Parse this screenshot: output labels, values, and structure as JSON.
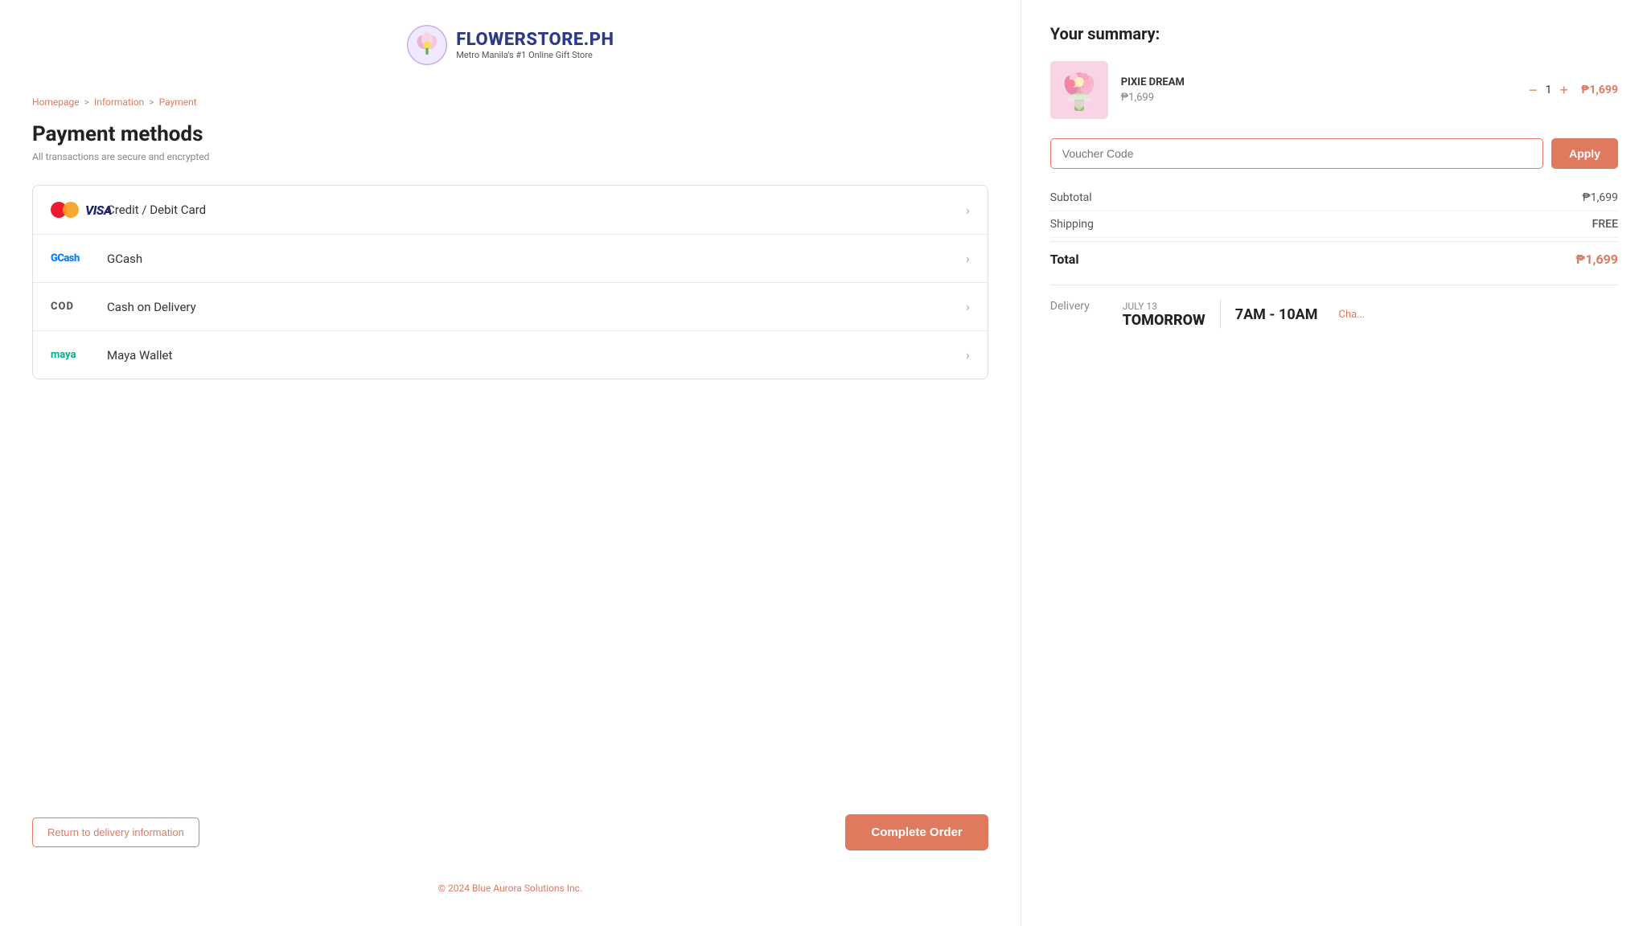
{
  "logo": {
    "title": "FLOWERSTORE.PH",
    "subtitle": "Metro Manila's #1 Online Gift Store"
  },
  "breadcrumb": {
    "homepage": "Homepage",
    "information": "Information",
    "payment": "Payment"
  },
  "page": {
    "title": "Payment methods",
    "secure_text": "All transactions are secure and encrypted"
  },
  "payment_methods": [
    {
      "id": "credit-debit",
      "label": "Credit / Debit Card",
      "icon_type": "visa"
    },
    {
      "id": "gcash",
      "label": "GCash",
      "icon_type": "gcash"
    },
    {
      "id": "cod",
      "label": "Cash on Delivery",
      "icon_type": "cod"
    },
    {
      "id": "maya",
      "label": "Maya Wallet",
      "icon_type": "maya"
    }
  ],
  "footer": {
    "return_label": "Return to delivery information",
    "complete_label": "Complete Order",
    "copyright": "© 2024 Blue Aurora Solutions Inc."
  },
  "summary": {
    "title": "Your summary:",
    "product": {
      "name": "PIXIE DREAM",
      "price": "₱1,699",
      "quantity": 1,
      "total": "₱1,699"
    },
    "voucher_placeholder": "Voucher Code",
    "apply_label": "Apply",
    "subtotal_label": "Subtotal",
    "subtotal_value": "₱1,699",
    "shipping_label": "Shipping",
    "shipping_value": "FREE",
    "total_label": "Total",
    "total_value": "₱1,699",
    "delivery_label": "Delivery",
    "delivery_date_month": "JULY 13",
    "delivery_date_day": "TOMORROW",
    "delivery_time": "7AM - 10AM",
    "change_label": "Cha..."
  }
}
